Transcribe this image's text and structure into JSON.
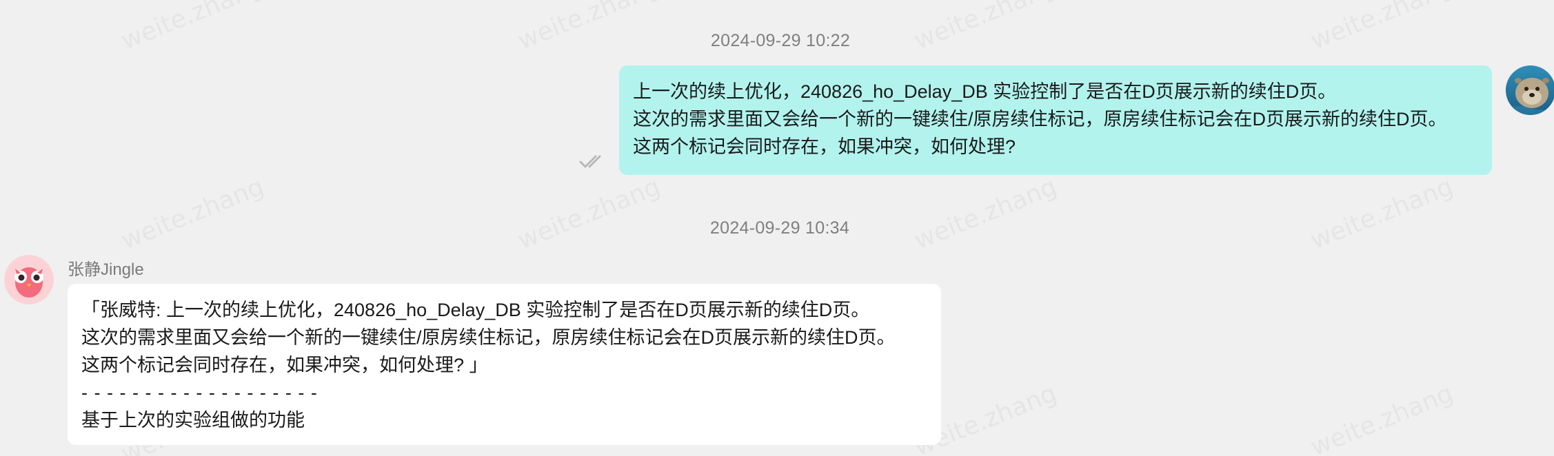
{
  "watermark_text": "weite.zhang",
  "messages": [
    {
      "timestamp": "2024-09-29 10:22",
      "direction": "outgoing",
      "lines": [
        "上一次的续上优化，240826_ho_Delay_DB 实验控制了是否在D页展示新的续住D页。",
        "这次的需求里面又会给一个新的一键续住/原房续住标记，原房续住标记会在D页展示新的续住D页。",
        "这两个标记会同时存在，如果冲突，如何处理?"
      ],
      "status_icon": "double-check-icon",
      "avatar_icon": "otter-avatar"
    },
    {
      "timestamp": "2024-09-29 10:34",
      "direction": "incoming",
      "sender": "张静Jingle",
      "lines": [
        "「张威特: 上一次的续上优化，240826_ho_Delay_DB 实验控制了是否在D页展示新的续住D页。",
        "这次的需求里面又会给一个新的一键续住/原房续住标记，原房续住标记会在D页展示新的续住D页。",
        "这两个标记会同时存在，如果冲突，如何处理? 」",
        "- - - - - - - - - - - - - - - - - - -",
        "基于上次的实验组做的功能"
      ],
      "avatar_icon": "pink-owl-avatar"
    }
  ],
  "colors": {
    "background": "#f0f0f0",
    "outgoing_bubble": "#b2f3ee",
    "incoming_bubble": "#ffffff",
    "timestamp": "#7f7f7f"
  }
}
